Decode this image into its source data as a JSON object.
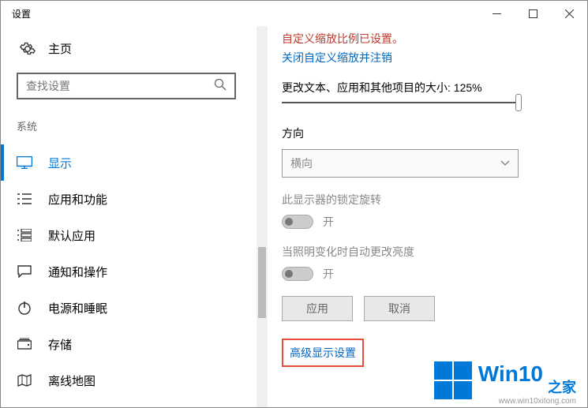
{
  "window": {
    "title": "设置"
  },
  "sidebar": {
    "home": "主页",
    "search_placeholder": "查找设置",
    "category": "系统",
    "items": [
      {
        "label": "显示"
      },
      {
        "label": "应用和功能"
      },
      {
        "label": "默认应用"
      },
      {
        "label": "通知和操作"
      },
      {
        "label": "电源和睡眠"
      },
      {
        "label": "存储"
      },
      {
        "label": "离线地图"
      }
    ]
  },
  "main": {
    "alert": "自定义缩放比例已设置。",
    "alert_link": "关闭自定义缩放并注销",
    "scale_label": "更改文本、应用和其他项目的大小: 125%",
    "orientation_label": "方向",
    "orientation_value": "横向",
    "lock_label": "此显示器的锁定旋转",
    "lock_state": "开",
    "brightness_label": "当照明变化时自动更改亮度",
    "brightness_state": "开",
    "apply_btn": "应用",
    "cancel_btn": "取消",
    "advanced_link": "高级显示设置"
  },
  "watermark": {
    "text1": "Win10",
    "text2": "之家",
    "url": "www.win10xitong.com"
  }
}
